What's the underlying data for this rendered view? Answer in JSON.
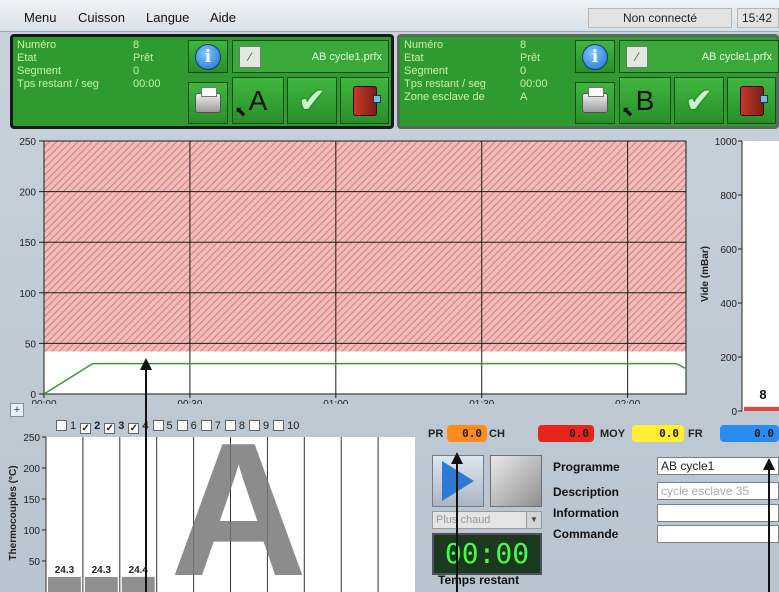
{
  "menu": {
    "items": [
      "Menu",
      "Cuisson",
      "Langue",
      "Aide"
    ],
    "status": "Non connecté",
    "clock": "15:42"
  },
  "panelA": {
    "rows": [
      {
        "label": "Numéro",
        "value": "8"
      },
      {
        "label": "Etat",
        "value": "Prêt"
      },
      {
        "label": "Segment",
        "value": "0"
      },
      {
        "label": "Tps restant / seg",
        "value": "00:00"
      }
    ],
    "file": "AB cycle1.prfx",
    "letter": "A"
  },
  "panelB": {
    "rows": [
      {
        "label": "Numéro",
        "value": "8"
      },
      {
        "label": "Etat",
        "value": "Prêt"
      },
      {
        "label": "Segment",
        "value": "0"
      },
      {
        "label": "Tps restant / seg",
        "value": "00:00"
      },
      {
        "label": "Zone esclave de",
        "value": "A"
      }
    ],
    "file": "AB cycle1.prfx",
    "letter": "B"
  },
  "chart_data": [
    {
      "type": "line",
      "x_ticks": [
        "00:00",
        "00:30",
        "01:00",
        "01:30",
        "02:00"
      ],
      "y_ticks": [
        0,
        50,
        100,
        150,
        200,
        250
      ],
      "ylim": [
        0,
        250
      ],
      "xlim_minutes": [
        0,
        132
      ],
      "shaded_band": [
        42,
        250
      ],
      "series": [
        {
          "x_minutes": [
            0,
            10,
            130,
            132
          ],
          "y": [
            0,
            30,
            30,
            25
          ]
        }
      ]
    },
    {
      "type": "bar",
      "ylabel": "Vide (mBar)",
      "y_ticks": [
        0,
        200,
        400,
        600,
        800,
        1000
      ],
      "ylim": [
        0,
        1000
      ],
      "values": [
        8
      ],
      "data_label": "8"
    },
    {
      "type": "bar",
      "ylabel": "Thermocouples (°C)",
      "y_ticks": [
        50,
        100,
        150,
        200,
        250
      ],
      "ylim": [
        0,
        250
      ],
      "categories": [
        "1",
        "2",
        "3",
        "4",
        "5",
        "6",
        "7",
        "8",
        "9",
        "10"
      ],
      "values": [
        24.3,
        24.3,
        24.4
      ],
      "data_labels": [
        "24.3",
        "24.3",
        "24.4"
      ]
    }
  ],
  "thermocouples": {
    "checkboxes": [
      {
        "label": "1",
        "checked": false
      },
      {
        "label": "2",
        "checked": true
      },
      {
        "label": "3",
        "checked": true
      },
      {
        "label": "4",
        "checked": true
      },
      {
        "label": "5",
        "checked": false
      },
      {
        "label": "6",
        "checked": false
      },
      {
        "label": "7",
        "checked": false
      },
      {
        "label": "8",
        "checked": false
      },
      {
        "label": "9",
        "checked": false
      },
      {
        "label": "10",
        "checked": false
      }
    ],
    "big_letter": "A"
  },
  "readouts": [
    {
      "label": "PR",
      "value": "0.0",
      "color": "#ff8a1e"
    },
    {
      "label": "CH",
      "value": "0.0",
      "color": "#e8231c"
    },
    {
      "label": "MOY",
      "value": "0.0",
      "color": "#ffee33"
    },
    {
      "label": "FR",
      "value": "0.0",
      "color": "#2b8cf0"
    }
  ],
  "controls": {
    "select": "Plus chaud",
    "timer": "00:00",
    "timer_label": "Temps restant"
  },
  "fields": [
    {
      "label": "Programme",
      "value": "AB cycle1"
    },
    {
      "label": "Description",
      "value": "cycle esclave 35"
    },
    {
      "label": "Information",
      "value": ""
    },
    {
      "label": "Commande",
      "value": ""
    }
  ],
  "colors": {
    "panel_green": "#2f9a2f",
    "band_red": "#e8a4a4",
    "grid": "#222222",
    "curve": "#3a9a3a"
  }
}
